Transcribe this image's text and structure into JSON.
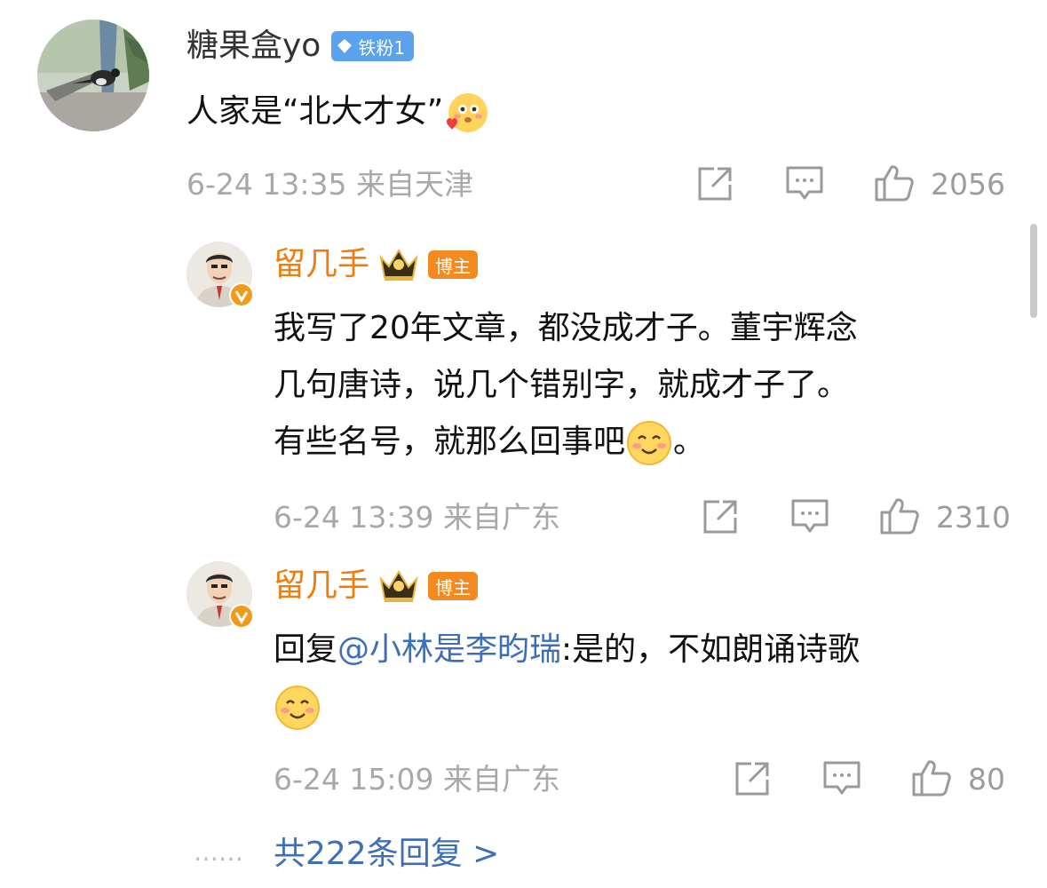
{
  "comment": {
    "user": "糖果盒yo",
    "badge": "铁粉1",
    "text_before": "人家是“北大才女”",
    "time": "6-24 13:35 来自天津",
    "likes": "2056"
  },
  "replies": [
    {
      "user": "留几手",
      "badge": "博主",
      "lines": [
        "我写了20年文章，都没成才子。董宇辉念",
        "几句唐诗，说几个错别字，就成才子了。",
        "有些名号，就那么回事吧"
      ],
      "line_end": "。",
      "time": "6-24 13:39 来自广东",
      "likes": "2310"
    },
    {
      "user": "留几手",
      "badge": "博主",
      "reply_prefix": "回复",
      "mention": "@小林是李昀瑞",
      "reply_text": ":是的，不如朗诵诗歌",
      "time": "6-24 15:09 来自广东",
      "likes": "80"
    }
  ],
  "footer": {
    "dots": "……",
    "more_replies": "共222条回复 >"
  },
  "colors": {
    "blogger_name": "#f07c0c",
    "link": "#3d6fb6",
    "fan_badge": "#5aa2ee",
    "meta_gray": "#a8a8a8"
  },
  "icons": [
    "share-icon",
    "comment-icon",
    "like-icon",
    "smile-emoji",
    "blush-emoji",
    "crown-icon",
    "verified-icon"
  ]
}
